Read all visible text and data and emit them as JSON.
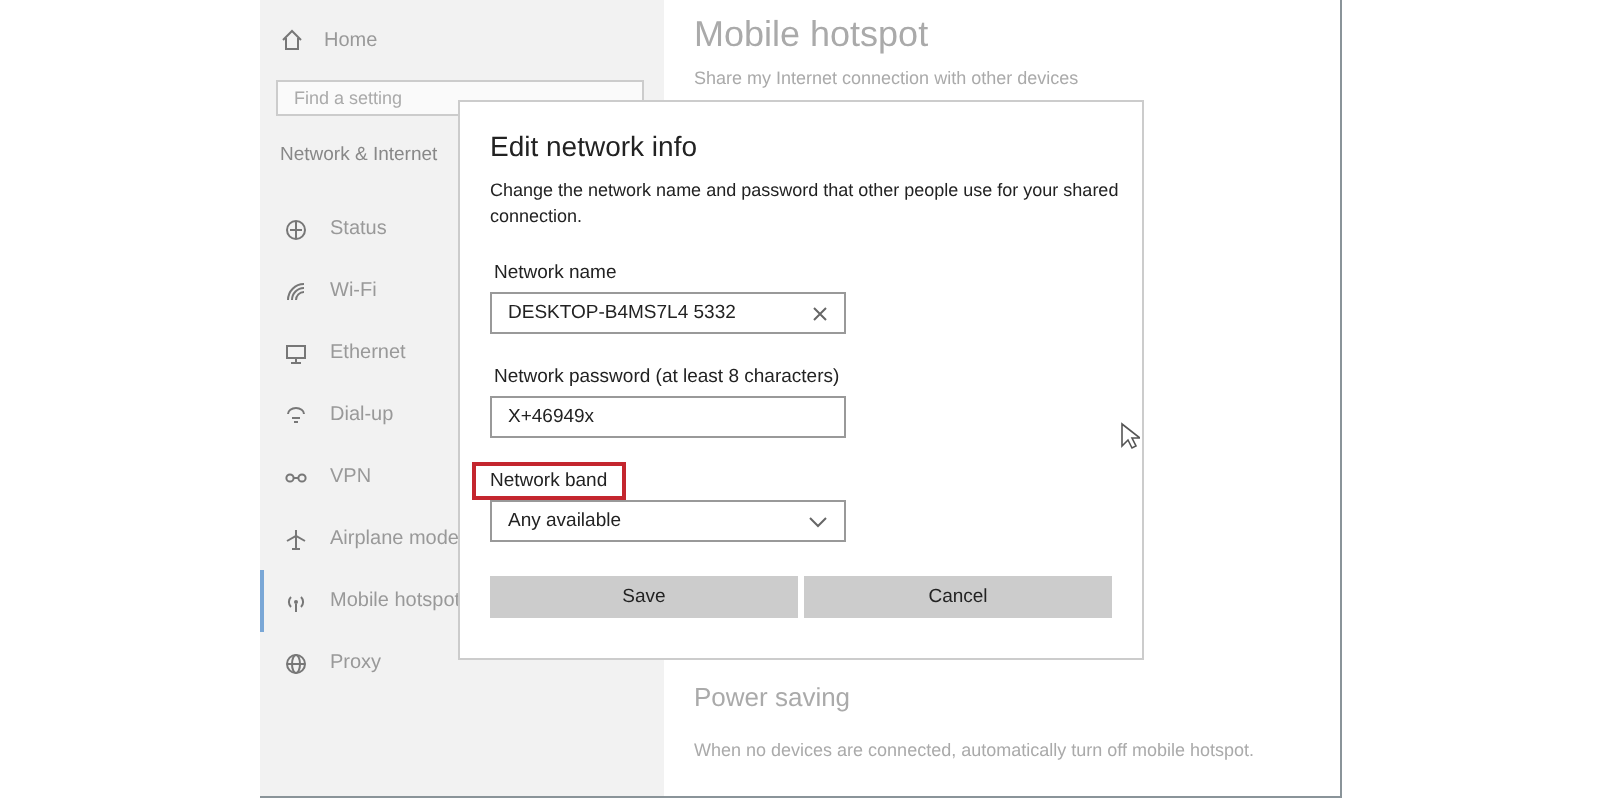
{
  "sidebar": {
    "home": "Home",
    "search": {
      "placeholder": "Find a setting"
    },
    "section_title": "Network & Internet",
    "items": [
      {
        "label": "Status",
        "selected": false
      },
      {
        "label": "Wi-Fi",
        "selected": false
      },
      {
        "label": "Ethernet",
        "selected": false
      },
      {
        "label": "Dial-up",
        "selected": false
      },
      {
        "label": "VPN",
        "selected": false
      },
      {
        "label": "Airplane mode",
        "selected": false
      },
      {
        "label": "Mobile hotspot",
        "selected": true
      },
      {
        "label": "Proxy",
        "selected": false
      }
    ]
  },
  "content": {
    "title": "Mobile hotspot",
    "subtitle": "Share my Internet connection with other devices",
    "power_saving": {
      "title": "Power saving",
      "description": "When no devices are connected, automatically turn off mobile hotspot."
    }
  },
  "dialog": {
    "title": "Edit network info",
    "description": "Change the network name and password that other people use for your shared connection.",
    "fields": [
      {
        "kind": "text",
        "label": "Network name",
        "value": "DESKTOP-B4MS7L4 5332",
        "highlighted": false
      },
      {
        "kind": "password",
        "label": "Network password (at least 8 characters)",
        "value": "X+46949x",
        "highlighted": false
      },
      {
        "kind": "dropdown",
        "label": "Network band",
        "value": "Any available",
        "highlighted": true
      }
    ],
    "buttons": [
      "Save",
      "Cancel"
    ]
  }
}
